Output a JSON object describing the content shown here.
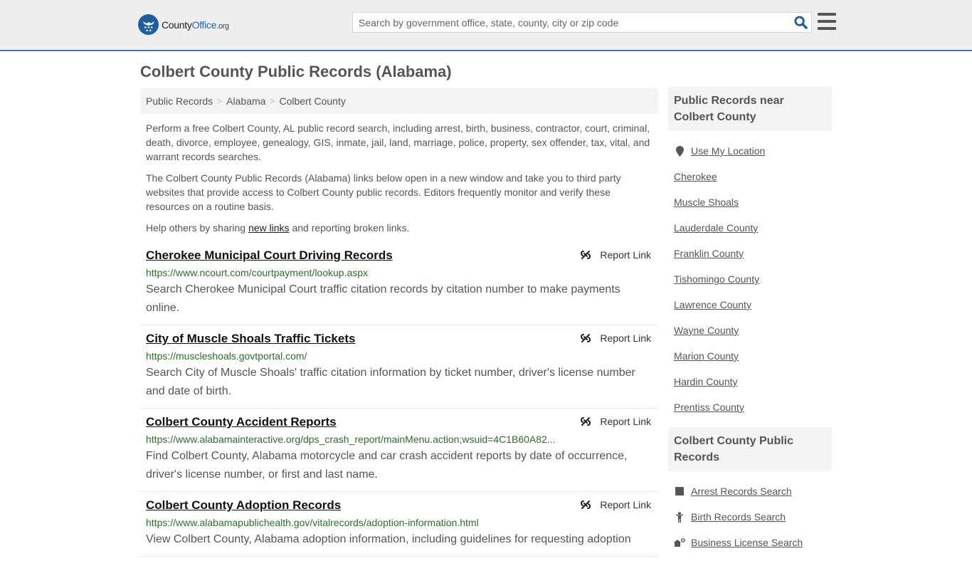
{
  "header": {
    "logo": {
      "prefix": "County",
      "highlight": "Office",
      "suffix": ".org"
    },
    "search": {
      "placeholder": "Search by government office, state, county, city or zip code",
      "value": ""
    },
    "icons": {
      "search": "search-icon",
      "menu": "hamburger-menu-icon"
    }
  },
  "page": {
    "title": "Colbert County Public Records (Alabama)",
    "breadcrumb": [
      {
        "label": "Public Records"
      },
      {
        "label": "Alabama"
      },
      {
        "label": "Colbert County"
      }
    ],
    "breadcrumb_separator": ">",
    "intro": {
      "p1": "Perform a free Colbert County, AL public record search, including arrest, birth, business, contractor, court, criminal, death, divorce, employee, genealogy, GIS, inmate, jail, land, marriage, police, property, sex offender, tax, vital, and warrant records searches.",
      "p2": "The Colbert County Public Records (Alabama) links below open in a new window and take you to third party websites that provide access to Colbert County public records. Editors frequently monitor and verify these resources on a routine basis.",
      "p3_before": "Help others by sharing ",
      "p3_link": "new links",
      "p3_after": " and reporting broken links."
    }
  },
  "records": [
    {
      "title": "Cherokee Municipal Court Driving Records",
      "url": "https://www.ncourt.com/courtpayment/lookup.aspx",
      "description": "Search Cherokee Municipal Court traffic citation records by citation number to make payments online.",
      "report_label": "Report Link"
    },
    {
      "title": "City of Muscle Shoals Traffic Tickets",
      "url": "https://muscleshoals.govtportal.com/",
      "description": "Search City of Muscle Shoals' traffic citation information by ticket number, driver's license number and date of birth.",
      "report_label": "Report Link"
    },
    {
      "title": "Colbert County Accident Reports",
      "url": "https://www.alabamainteractive.org/dps_crash_report/mainMenu.action;wsuid=4C1B60A82...",
      "description": "Find Colbert County, Alabama motorcycle and car crash accident reports by date of occurrence, driver's license number, or first and last name.",
      "report_label": "Report Link"
    },
    {
      "title": "Colbert County Adoption Records",
      "url": "https://www.alabamapublichealth.gov/vitalrecords/adoption-information.html",
      "description": "View Colbert County, Alabama adoption information, including guidelines for requesting adoption",
      "report_label": "Report Link"
    }
  ],
  "sidebar": {
    "nearby": {
      "heading": "Public Records near Colbert County",
      "use_location": "Use My Location",
      "items": [
        "Cherokee",
        "Muscle Shoals",
        "Lauderdale County",
        "Franklin County",
        "Tishomingo County",
        "Lawrence County",
        "Wayne County",
        "Marion County",
        "Hardin County",
        "Prentiss County"
      ]
    },
    "county_records": {
      "heading": "Colbert County Public Records",
      "items": [
        {
          "label": "Arrest Records Search",
          "icon": "square-icon"
        },
        {
          "label": "Birth Records Search",
          "icon": "baby-icon"
        },
        {
          "label": "Business License Search",
          "icon": "business-icon"
        }
      ]
    }
  },
  "colors": {
    "brand_blue": "#1d5e9e",
    "header_border": "#3a7aad",
    "url_green": "#2b6f2b"
  }
}
